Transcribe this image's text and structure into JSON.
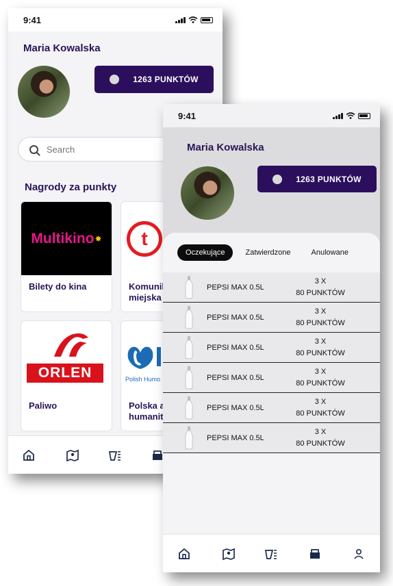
{
  "status": {
    "time": "9:41"
  },
  "user": {
    "name": "Maria Kowalska",
    "points_label": "1263 PUNKTÓW"
  },
  "search": {
    "placeholder": "Search"
  },
  "rewards": {
    "title": "Nagrody za punkty",
    "cards": [
      {
        "label": "Bilety do kina",
        "logo_text": "Multikino"
      },
      {
        "label": "Komunikacja miejska",
        "label_visible": "Komunik\nmiejska",
        "logo_text": "t"
      },
      {
        "label": "Paliwo",
        "logo_text": "ORLEN"
      },
      {
        "label": "Polska akcja humanitarna",
        "label_visible": "Polska a\nhumanit",
        "logo_text": "Polish Humo"
      }
    ]
  },
  "nav": {
    "icons": [
      "home-icon",
      "map-icon",
      "rewards-icon",
      "basket-icon",
      "profile-icon"
    ]
  },
  "orders": {
    "tabs": [
      "Oczekujące",
      "Zatwierdzone",
      "Anulowane"
    ],
    "active_tab": "Oczekujące",
    "items": [
      {
        "name": "PEPSI MAX 0.5L",
        "qty": "3 X",
        "points": "80 PUNKTÓW"
      },
      {
        "name": "PEPSI MAX 0.5L",
        "qty": "3 X",
        "points": "80 PUNKTÓW"
      },
      {
        "name": "PEPSI MAX 0.5L",
        "qty": "3 X",
        "points": "80 PUNKTÓW"
      },
      {
        "name": "PEPSI MAX 0.5L",
        "qty": "3 X",
        "points": "80 PUNKTÓW"
      },
      {
        "name": "PEPSI MAX 0.5L",
        "qty": "3 X",
        "points": "80 PUNKTÓW"
      },
      {
        "name": "PEPSI MAX 0.5L",
        "qty": "3 X",
        "points": "80 PUNKTÓW"
      }
    ]
  },
  "colors": {
    "brand": "#2c0f5c",
    "title": "#2a1457",
    "multikino": "#e6178a",
    "orlen": "#d9121b",
    "tram": "#e41b23"
  }
}
